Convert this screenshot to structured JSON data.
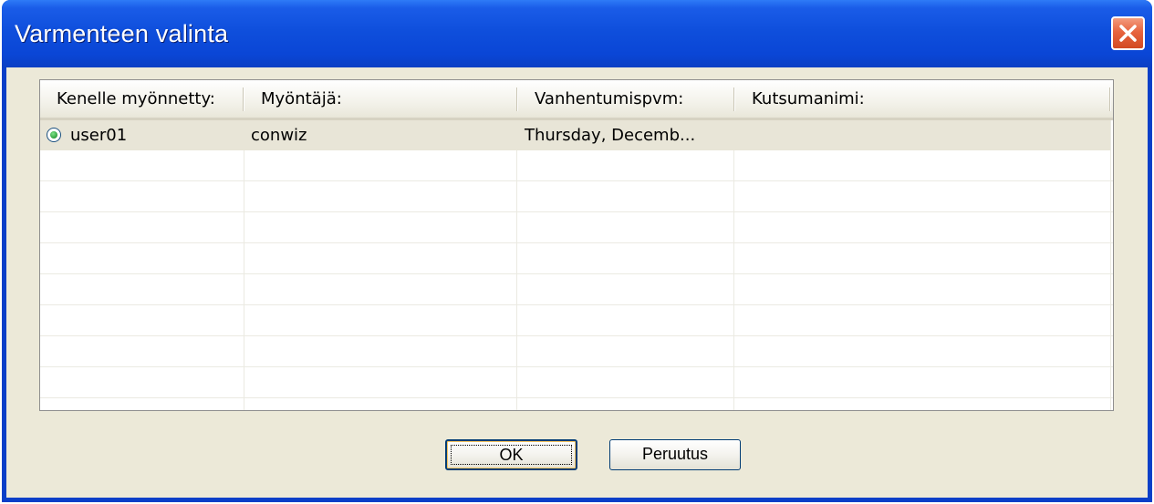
{
  "window": {
    "title": "Varmenteen valinta"
  },
  "table": {
    "columns": [
      "Kenelle myönnetty:",
      "Myöntäjä:",
      "Vanhentumispvm:",
      "Kutsumanimi:"
    ],
    "rows": [
      {
        "selected": true,
        "issued_to": "user01",
        "issuer": "conwiz",
        "expires": "Thursday, Decemb...",
        "friendly_name": ""
      }
    ]
  },
  "buttons": {
    "ok_label": "OK",
    "cancel_label": "Peruutus"
  },
  "colors": {
    "titlebar": "#0a46d6",
    "client_background": "#ece9d8",
    "close_button": "#e7643f",
    "selected_row": "#e8e5d7"
  }
}
